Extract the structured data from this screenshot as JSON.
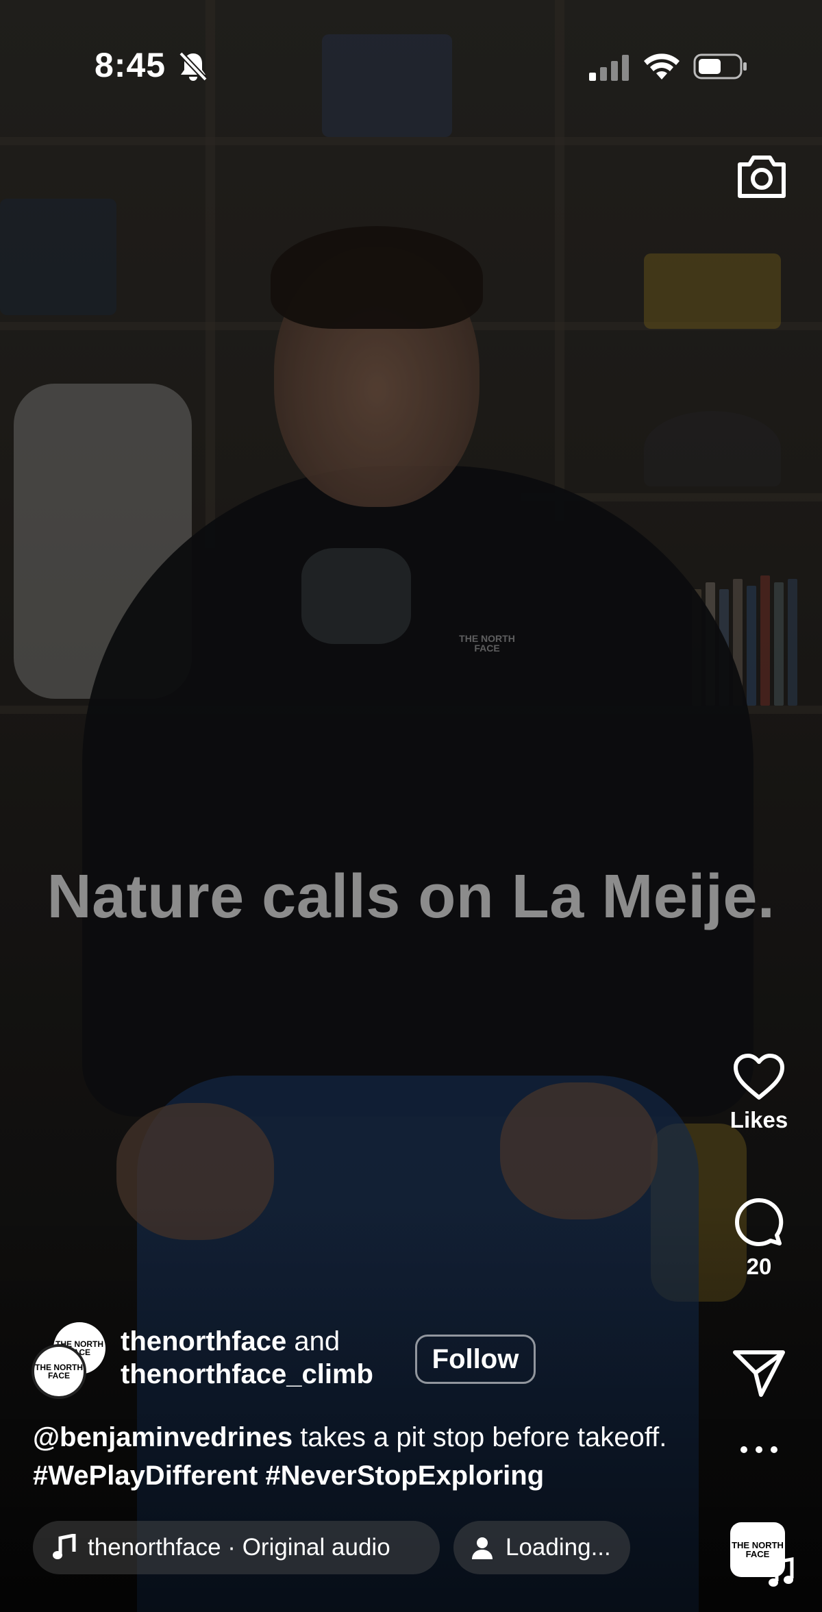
{
  "status_bar": {
    "time": "8:45",
    "silent_icon": "bell-slash-icon",
    "signal_icon": "cellular-signal-icon",
    "wifi_icon": "wifi-icon",
    "battery_icon": "battery-icon"
  },
  "top_actions": {
    "camera_icon": "camera-icon"
  },
  "video": {
    "caption": "Nature calls on La Meije.",
    "jacket_logo_text": "THE NORTH FACE"
  },
  "rail": {
    "like_label": "Likes",
    "comment_count": "20",
    "share_icon": "paper-plane-icon",
    "more_icon": "more-horizontal-icon",
    "audio_thumb_text": "THE NORTH FACE"
  },
  "post": {
    "author_primary": "thenorthface",
    "author_joiner": " and",
    "author_secondary": "thenorthface_climb",
    "avatar_text": "THE NORTH FACE",
    "follow_label": "Follow",
    "description_mention": "@benjaminvedrines",
    "description_text": " takes a pit stop before takeoff. ",
    "hashtag_1": "#WePlayDifferent",
    "hashtag_2": "#NeverStopExploring"
  },
  "pills": {
    "audio_text": "thenorthface · Original audio",
    "loading_text": "Loading..."
  },
  "colors": {
    "text": "#ffffff",
    "caption": "#8c8c8c",
    "pill_bg": "#505050"
  }
}
